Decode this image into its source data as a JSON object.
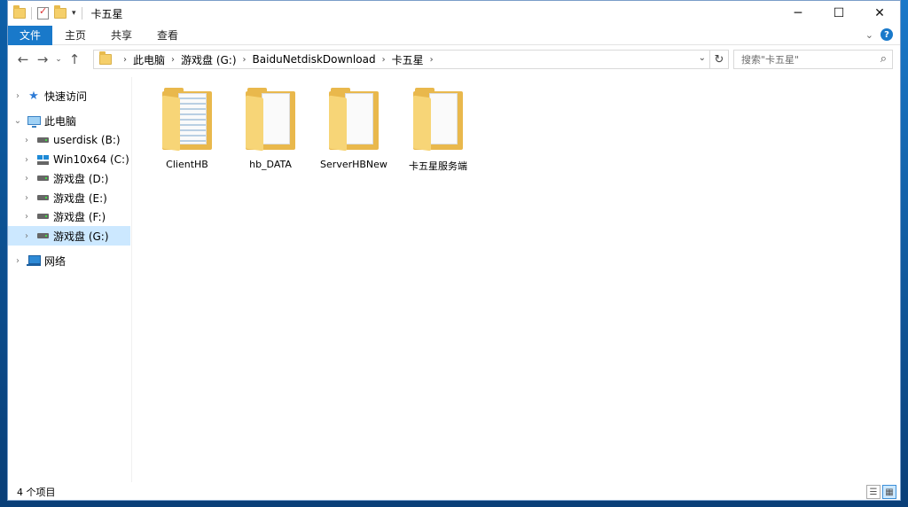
{
  "window": {
    "title": "卡五星"
  },
  "ribbon": {
    "tabs": [
      "文件",
      "主页",
      "共享",
      "查看"
    ]
  },
  "address": {
    "crumbs": [
      "此电脑",
      "游戏盘 (G:)",
      "BaiduNetdiskDownload",
      "卡五星"
    ]
  },
  "search": {
    "placeholder": "搜索\"卡五星\""
  },
  "nav": {
    "quick_access": "快速访问",
    "this_pc": "此电脑",
    "drives": [
      "userdisk (B:)",
      "Win10x64 (C:)",
      "游戏盘 (D:)",
      "游戏盘 (E:)",
      "游戏盘 (F:)",
      "游戏盘 (G:)"
    ],
    "network": "网络",
    "selected": "游戏盘 (G:)"
  },
  "files": [
    "ClientHB",
    "hb_DATA",
    "ServerHBNew",
    "卡五星服务端"
  ],
  "status": {
    "count_text": "4 个项目"
  },
  "colors": {
    "accent": "#1979ca",
    "selection": "#cce8ff",
    "folder": "#e9b84c"
  }
}
